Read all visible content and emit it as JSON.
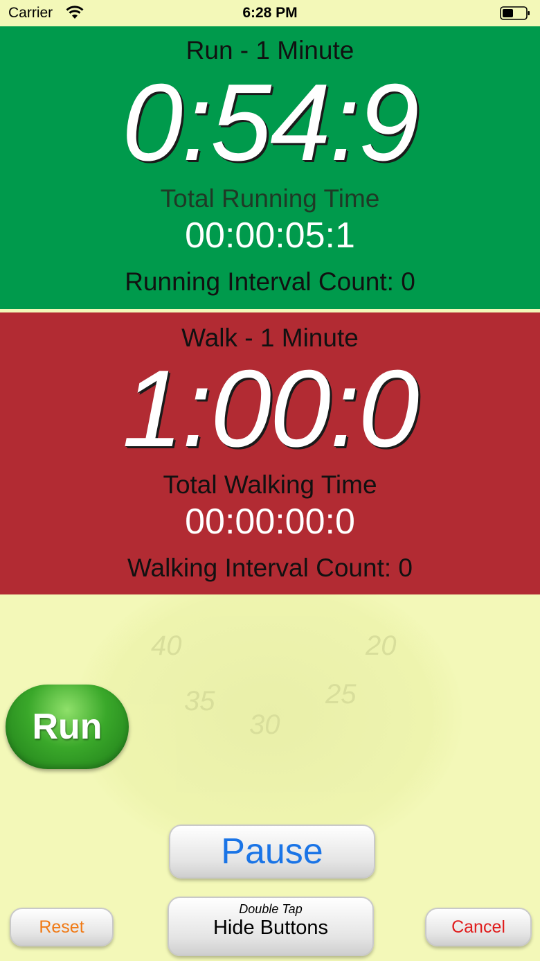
{
  "status_bar": {
    "carrier": "Carrier",
    "time": "6:28 PM"
  },
  "run_panel": {
    "title": "Run - 1 Minute",
    "countdown": "0:54:9",
    "total_label": "Total Running Time",
    "total_time": "00:00:05:1",
    "interval_count": "Running Interval Count: 0",
    "color": "#009a4c"
  },
  "walk_panel": {
    "title": "Walk - 1 Minute",
    "countdown": "1:00:0",
    "total_label": "Total Walking Time",
    "total_time": "00:00:00:0",
    "interval_count": "Walking Interval Count: 0",
    "color": "#b22b33"
  },
  "watermark": {
    "dial_numbers": [
      "40",
      "20",
      "35",
      "25",
      "30"
    ]
  },
  "buttons": {
    "run": "Run",
    "pause": "Pause",
    "reset": "Reset",
    "cancel": "Cancel",
    "hide_hint": "Double Tap",
    "hide": "Hide Buttons"
  }
}
